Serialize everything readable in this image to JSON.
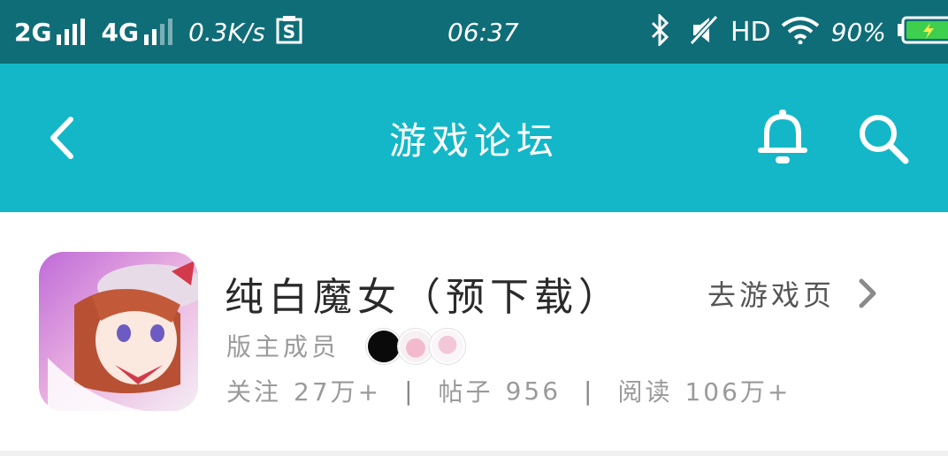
{
  "status_bar": {
    "network1": "2G",
    "network2": "4G",
    "speed": "0.3K/s",
    "time": "06:37",
    "hd": "HD",
    "battery": "90%",
    "battery_level": 0.9,
    "battery_color": "#3ecf4e",
    "icons": [
      "signal-icon",
      "s-notification-icon",
      "bluetooth-icon",
      "muted-icon",
      "wifi-icon",
      "battery-icon"
    ]
  },
  "app_bar": {
    "title": "游戏论坛",
    "icons": [
      "back-icon",
      "bell-icon",
      "search-icon"
    ],
    "color": "#14b7c7"
  },
  "forum_card": {
    "game_title": "纯白魔女（预下载）",
    "goto_label": "去游戏页",
    "moderator_label": "版主成员",
    "stats": {
      "follow_label": "关注",
      "follow_value": "27万+",
      "posts_label": "帖子",
      "posts_value": "956",
      "reads_label": "阅读",
      "reads_value": "106万+"
    }
  }
}
